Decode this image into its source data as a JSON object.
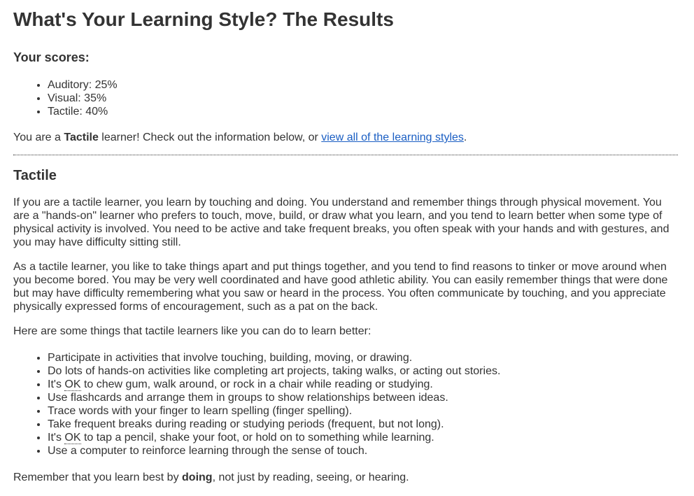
{
  "title": "What's Your Learning Style? The Results",
  "scores": {
    "heading": "Your scores:",
    "items": [
      {
        "label": "Auditory: 25%"
      },
      {
        "label": "Visual: 35%"
      },
      {
        "label": "Tactile: 40%"
      }
    ]
  },
  "result": {
    "prefix": "You are a ",
    "style": "Tactile",
    "middle": " learner! Check out the information below, or ",
    "link_text": "view all of the learning styles",
    "suffix": "."
  },
  "section": {
    "heading": "Tactile",
    "para1": "If you are a tactile learner, you learn by touching and doing. You understand and remember things through physical movement. You are a \"hands-on\" learner who prefers to touch, move, build, or draw what you learn, and you tend to learn better when some type of physical activity is involved. You need to be active and take frequent breaks, you often speak with your hands and with gestures, and you may have difficulty sitting still.",
    "para2": "As a tactile learner, you like to take things apart and put things together, and you tend to find reasons to tinker or move around when you become bored. You may be very well coordinated and have good athletic ability. You can easily remember things that were done but may have difficulty remembering what you saw or heard in the process. You often communicate by touching, and you appreciate physically expressed forms of encouragement, such as a pat on the back.",
    "para3": "Here are some things that tactile learners like you can do to learn better:",
    "tips": [
      {
        "text": "Participate in activities that involve touching, building, moving, or drawing."
      },
      {
        "text": "Do lots of hands-on activities like completing art projects, taking walks, or acting out stories."
      },
      {
        "pre": "It's ",
        "abbr": "OK",
        "post": " to chew gum, walk around, or rock in a chair while reading or studying."
      },
      {
        "text": "Use flashcards and arrange them in groups to show relationships between ideas."
      },
      {
        "text": "Trace words with your finger to learn spelling (finger spelling)."
      },
      {
        "text": "Take frequent breaks during reading or studying periods (frequent, but not long)."
      },
      {
        "pre": "It's ",
        "abbr": "OK",
        "post": " to tap a pencil, shake your foot, or hold on to something while learning."
      },
      {
        "text": "Use a computer to reinforce learning through the sense of touch."
      }
    ],
    "closing": {
      "prefix": "Remember that you learn best by ",
      "bold": "doing",
      "suffix": ", not just by reading, seeing, or hearing."
    }
  }
}
